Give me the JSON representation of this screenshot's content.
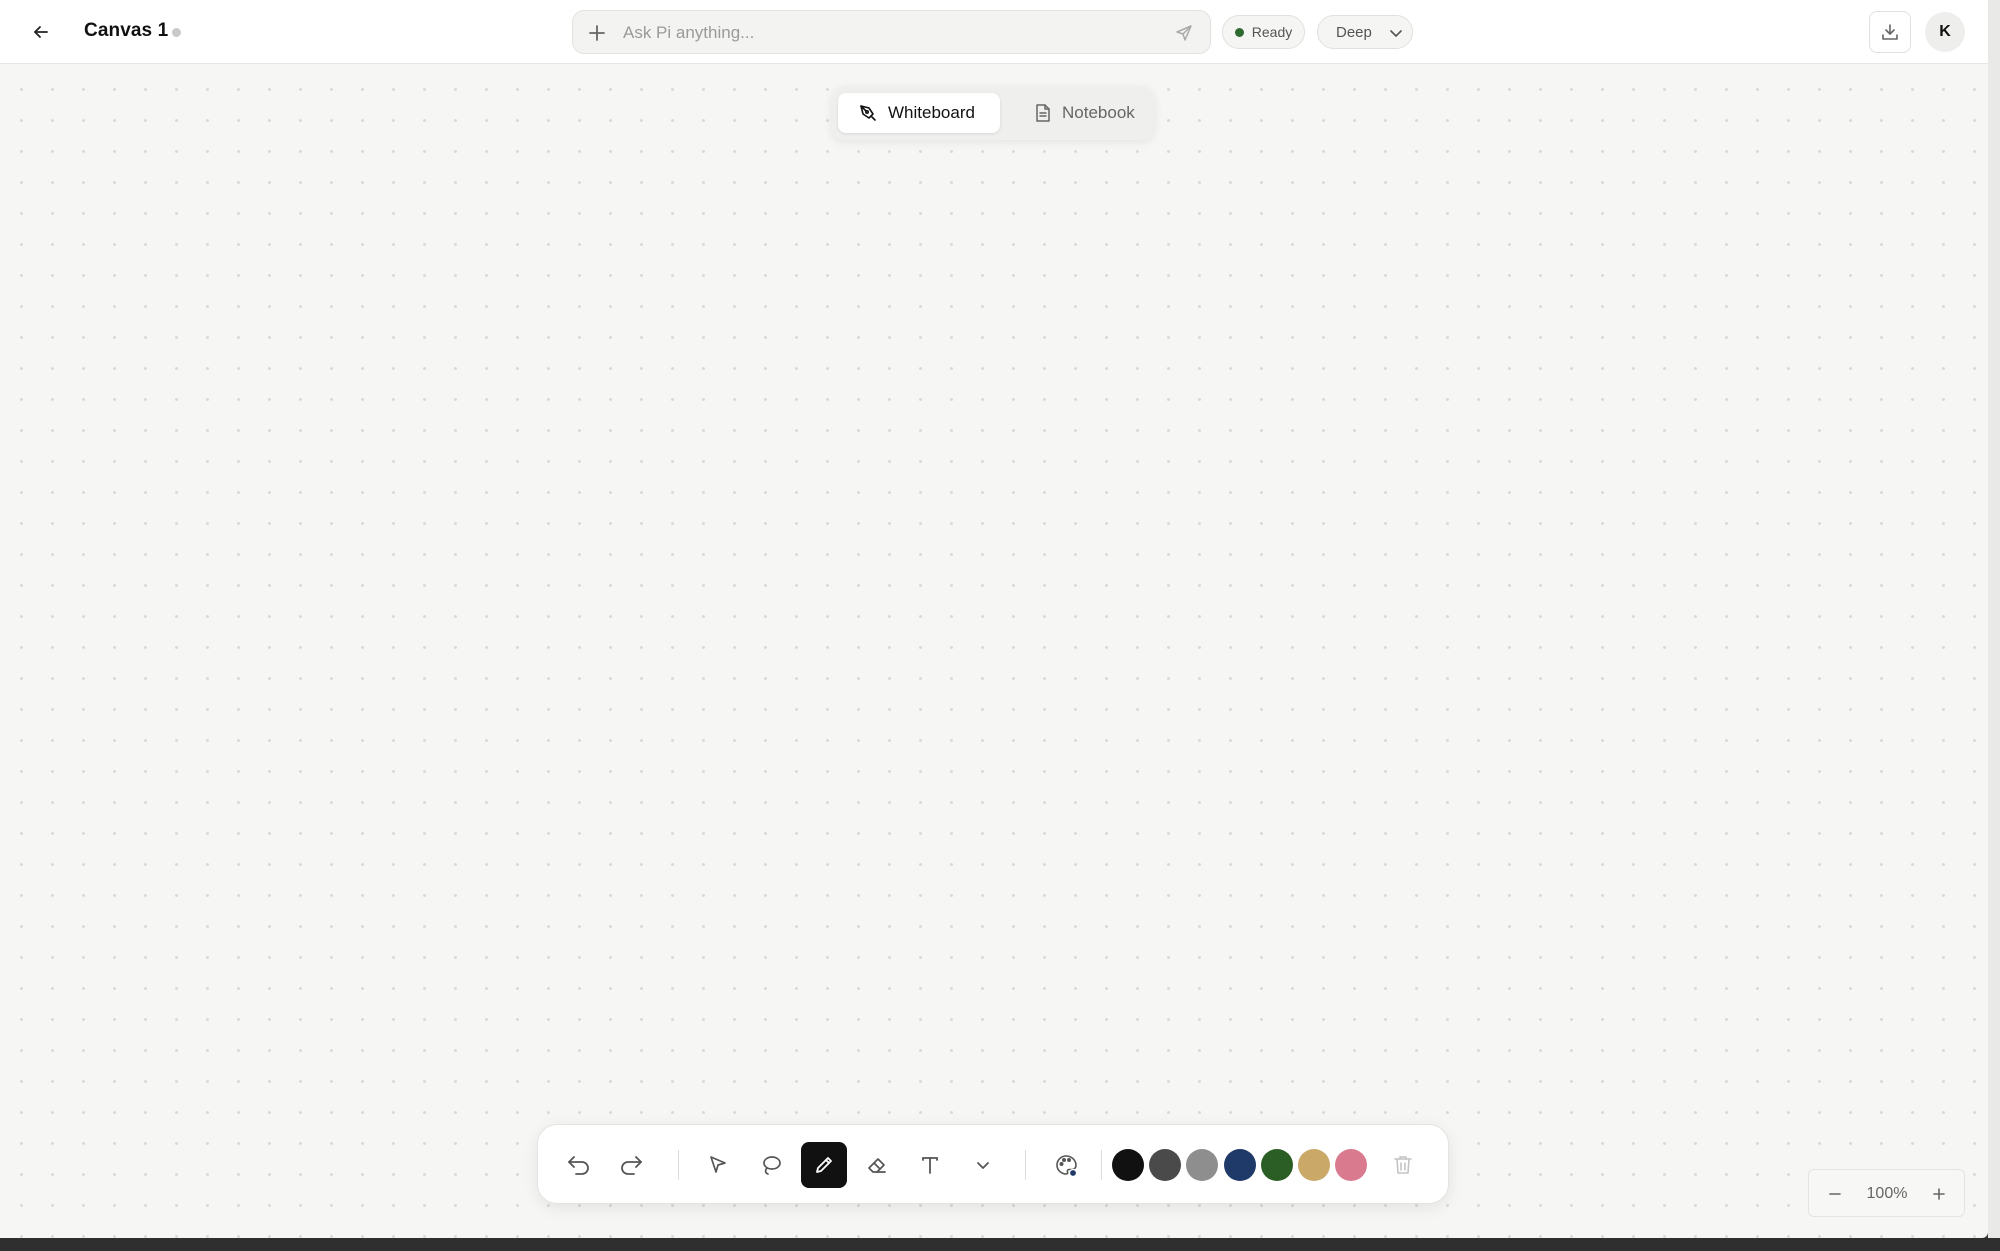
{
  "header": {
    "title": "Canvas 1",
    "ask_placeholder": "Ask Pi anything...",
    "status_label": "Ready",
    "mode_label": "Deep",
    "avatar_initial": "K"
  },
  "tabs": [
    {
      "label": "Whiteboard",
      "active": true
    },
    {
      "label": "Notebook",
      "active": false
    }
  ],
  "toolbar": {
    "tools": [
      "undo-icon",
      "redo-icon",
      "select-icon",
      "lasso-icon",
      "pen-icon",
      "eraser-icon",
      "text-icon",
      "chevron-down-icon",
      "palette-icon",
      "trash-icon"
    ],
    "active_tool": "pen",
    "colors": [
      "#111111",
      "#4a4a4a",
      "#8e8e8e",
      "#1f3a68",
      "#2b5e24",
      "#c9a868",
      "#d97a8f"
    ]
  },
  "zoom": {
    "level": "100%"
  },
  "colors": {
    "status_dot": "#2f6b2f",
    "canvas_bg": "#f6f6f5"
  }
}
